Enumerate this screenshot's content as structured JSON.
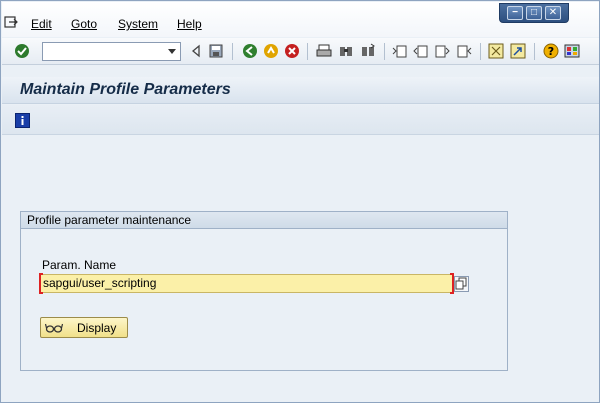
{
  "menu": {
    "items": [
      {
        "label": "Edit"
      },
      {
        "label": "Goto"
      },
      {
        "label": "System"
      },
      {
        "label": "Help"
      }
    ]
  },
  "window_controls": {
    "minimize": "−",
    "maximize": "□",
    "close": "✕"
  },
  "toolbar": {
    "command_field_value": "",
    "icons": [
      "enter-icon",
      "back-icon",
      "save-icon",
      "back-nav-icon",
      "exit-icon",
      "cancel-icon",
      "print-icon",
      "find-icon",
      "find-next-icon",
      "first-page-icon",
      "previous-page-icon",
      "next-page-icon",
      "last-page-icon",
      "create-session-icon",
      "shortcut-icon",
      "help-icon",
      "customize-layout-icon"
    ]
  },
  "title": "Maintain Profile Parameters",
  "app_toolbar": {
    "info_icon": "info-icon"
  },
  "groupbox": {
    "title": "Profile parameter maintenance",
    "param_label": "Param. Name",
    "param_value": "sapgui/user_scripting",
    "display_button": "Display"
  },
  "colors": {
    "input_required_bg": "#fbf0a8",
    "title_color": "#152c48",
    "window_blue": "#2d4f7f"
  }
}
